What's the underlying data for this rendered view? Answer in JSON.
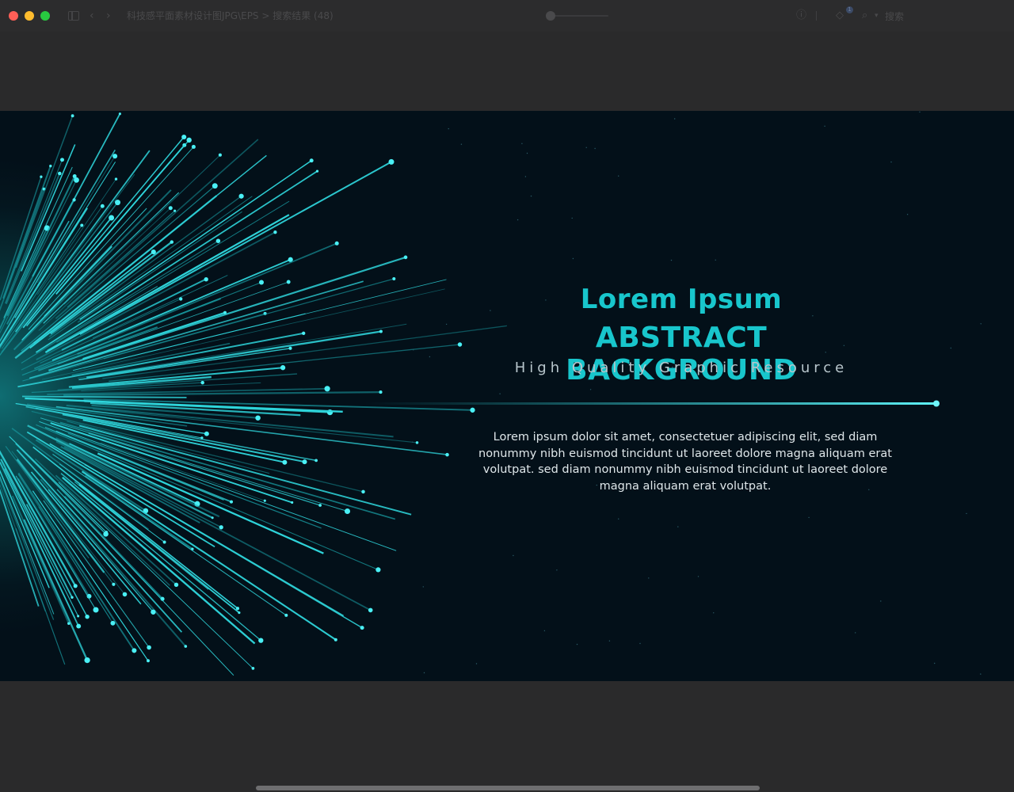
{
  "window": {
    "title": "科技感平面素材设计图JPG\\EPS > 搜索结果 (48)",
    "search_label": "搜索",
    "badge_count": "1"
  },
  "icons": {
    "sidebar": "sidebar-icon",
    "back": "chevron-left-icon",
    "forward": "chevron-right-icon",
    "info": "info-icon",
    "tag": "tag-icon",
    "search": "magnifier-icon"
  },
  "colors": {
    "accent": "#18c6cc",
    "canvas_bg": "#031019",
    "glow": "#0f6d72"
  },
  "image": {
    "title_line1": "Lorem Ipsum",
    "title_line2": "ABSTRACT BACKGROUND",
    "tagline": "High Quality Graphic Resource",
    "body": "Lorem ipsum dolor sit amet, consectetuer adipiscing elit, sed diam nonummy nibh euismod tincidunt ut laoreet dolore magna aliquam erat volutpat. sed diam nonummy nibh euismod tincidunt ut laoreet dolore magna aliquam erat volutpat."
  }
}
